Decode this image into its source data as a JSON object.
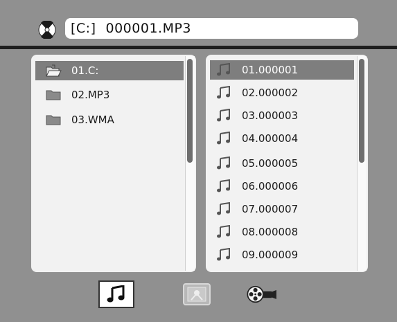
{
  "header": {
    "drive": "[C:]",
    "current_file": "000001.MP3"
  },
  "folders": [
    {
      "label": "01.C:",
      "selected": true
    },
    {
      "label": "02.MP3",
      "selected": false
    },
    {
      "label": "03.WMA",
      "selected": false
    }
  ],
  "files": [
    {
      "label": "01.000001",
      "selected": true
    },
    {
      "label": "02.000002",
      "selected": false
    },
    {
      "label": "03.000003",
      "selected": false
    },
    {
      "label": "04.000004",
      "selected": false
    },
    {
      "label": "05.000005",
      "selected": false
    },
    {
      "label": "06.000006",
      "selected": false
    },
    {
      "label": "07.000007",
      "selected": false
    },
    {
      "label": "08.000008",
      "selected": false
    },
    {
      "label": "09.000009",
      "selected": false
    }
  ],
  "tabs": [
    {
      "name": "music",
      "icon": "music-note-icon",
      "active": true
    },
    {
      "name": "photo",
      "icon": "photo-icon",
      "active": false
    },
    {
      "name": "movie",
      "icon": "film-reel-icon",
      "active": false
    }
  ],
  "colors": {
    "background": "#909090",
    "panel": "#f2f2f2",
    "selection": "#7e7e7e",
    "divider": "#1f1f1f"
  }
}
